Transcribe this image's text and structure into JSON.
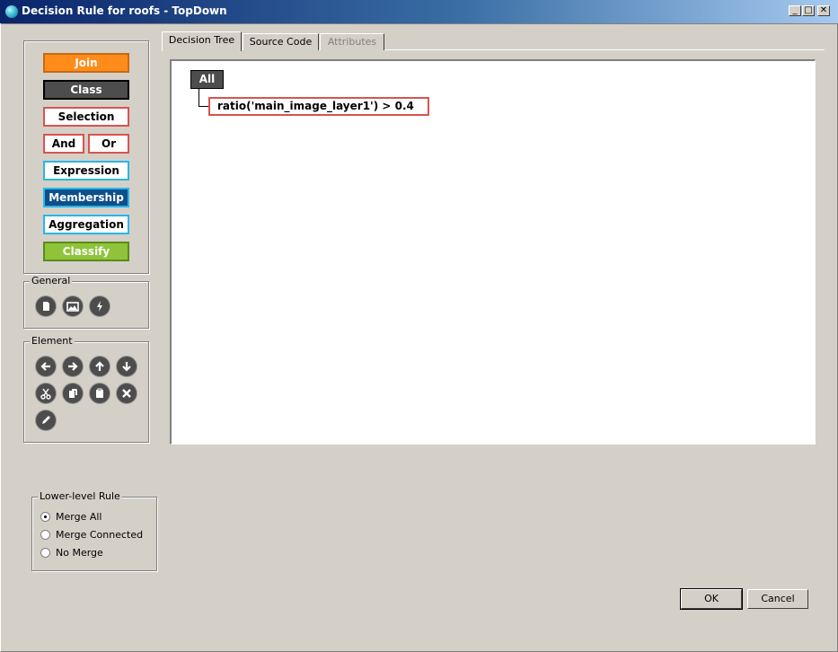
{
  "window": {
    "title": "Decision Rule for roofs - TopDown",
    "minimize_glyph": "_",
    "maximize_glyph": "□",
    "close_glyph": "✕"
  },
  "palette": {
    "buttons": [
      {
        "key": "join",
        "label": "Join",
        "bg": "#ff8c1a",
        "fg": "#ffffff",
        "border": "#c86a10"
      },
      {
        "key": "class",
        "label": "Class",
        "bg": "#4d4d4d",
        "fg": "#ffffff",
        "border": "#000000"
      },
      {
        "key": "selection",
        "label": "Selection",
        "bg": "#ffffff",
        "fg": "#000000",
        "border": "#d9534f"
      },
      {
        "key": "and",
        "label": "And",
        "bg": "#ffffff",
        "fg": "#000000",
        "border": "#d9534f"
      },
      {
        "key": "or",
        "label": "Or",
        "bg": "#ffffff",
        "fg": "#000000",
        "border": "#d9534f"
      },
      {
        "key": "expression",
        "label": "Expression",
        "bg": "#ffffff",
        "fg": "#000000",
        "border": "#29b6e8"
      },
      {
        "key": "membership",
        "label": "Membership",
        "bg": "#0d4f8b",
        "fg": "#ffffff",
        "border": "#29b6e8"
      },
      {
        "key": "aggregation",
        "label": "Aggregation",
        "bg": "#ffffff",
        "fg": "#000000",
        "border": "#29b6e8"
      },
      {
        "key": "classify",
        "label": "Classify",
        "bg": "#8fc43a",
        "fg": "#ffffff",
        "border": "#5c8a1a"
      }
    ]
  },
  "general": {
    "title": "General",
    "icons": [
      "new-document-icon",
      "image-icon",
      "lightning-icon"
    ]
  },
  "element": {
    "title": "Element",
    "icons": [
      "arrow-left-icon",
      "arrow-right-icon",
      "arrow-up-icon",
      "arrow-down-icon",
      "cut-icon",
      "copy-icon",
      "paste-icon",
      "delete-icon",
      "edit-icon"
    ]
  },
  "tabs": [
    {
      "label": "Decision Tree",
      "active": true
    },
    {
      "label": "Source Code",
      "active": false
    },
    {
      "label": "Attributes",
      "active": false,
      "disabled": true
    }
  ],
  "tree": {
    "root_label": "All",
    "condition_label": "ratio('main_image_layer1') > 0.4"
  },
  "lower_level_rule": {
    "title": "Lower-level Rule",
    "options": [
      {
        "label": "Merge All",
        "selected": true
      },
      {
        "label": "Merge Connected",
        "selected": false
      },
      {
        "label": "No Merge",
        "selected": false
      }
    ]
  },
  "dialog": {
    "ok_label": "OK",
    "cancel_label": "Cancel"
  }
}
